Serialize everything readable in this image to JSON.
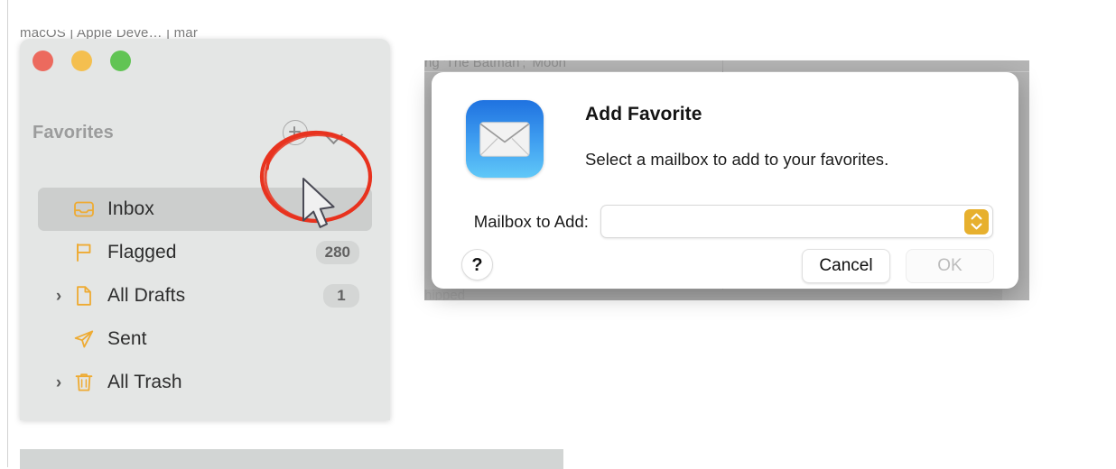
{
  "background": {
    "top_strip_text": "macOS | Apple Deve…   | mar",
    "behind_dialog_top_text": "ng 'The Batman'; 'Moon",
    "behind_dialog_bottom_text": "hipped"
  },
  "mail_window": {
    "traffic_lights": [
      {
        "name": "close-button",
        "color": "#ec6a5e"
      },
      {
        "name": "minimize-button",
        "color": "#f4bf4f"
      },
      {
        "name": "zoom-button",
        "color": "#61c454"
      }
    ],
    "sidebar": {
      "section_title": "Favorites",
      "add_button_icon": "plus-circle-icon",
      "chevron_button_icon": "chevron-down-icon",
      "items": [
        {
          "label": "Inbox",
          "icon": "inbox-icon",
          "badge": "",
          "disclosure": false,
          "selected": true
        },
        {
          "label": "Flagged",
          "icon": "flag-icon",
          "badge": "280",
          "disclosure": false,
          "selected": false
        },
        {
          "label": "All Drafts",
          "icon": "draft-icon",
          "badge": "1",
          "disclosure": true,
          "selected": false
        },
        {
          "label": "Sent",
          "icon": "sent-icon",
          "badge": "",
          "disclosure": false,
          "selected": false
        },
        {
          "label": "All Trash",
          "icon": "trash-icon",
          "badge": "",
          "disclosure": true,
          "selected": false
        }
      ]
    }
  },
  "annotation": {
    "shape": "red-ellipse-highlight",
    "color": "#e8331f",
    "cursor": "mouse-pointer-arrow"
  },
  "dialog": {
    "app_icon": "mail-app-icon",
    "title": "Add Favorite",
    "message": "Select a mailbox to add to your favorites.",
    "field_label": "Mailbox to Add:",
    "field_value": "",
    "field_stepper_icon": "up-down-chevron-icon",
    "field_accent_color": "#e7b02e",
    "help_button_label": "?",
    "cancel_button_label": "Cancel",
    "ok_button_label": "OK",
    "ok_enabled": false
  }
}
